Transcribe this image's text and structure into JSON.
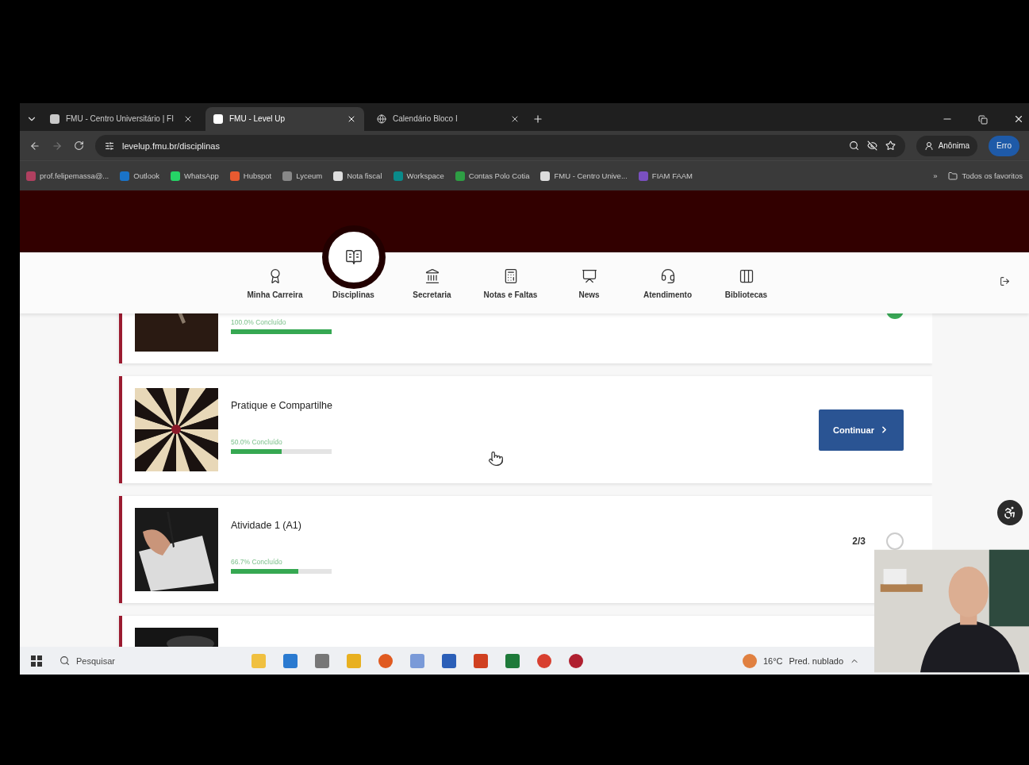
{
  "browser": {
    "tabs": [
      {
        "title": "FMU - Centro Universitário | FI",
        "selected": false
      },
      {
        "title": "FMU - Level Up",
        "selected": true
      },
      {
        "title": "Calendário Bloco I",
        "selected": false
      }
    ],
    "address": "levelup.fmu.br/disciplinas",
    "profile": "Anônima",
    "error_badge": "Erro",
    "bookmarks": [
      "prof.felipemassa@...",
      "Outlook",
      "WhatsApp",
      "Hubspot",
      "Lyceum",
      "Nota fiscal",
      "Workspace",
      "Contas Polo Cotia",
      "FMU - Centro Unive...",
      "FIAM FAAM"
    ],
    "bookmarks_more": "»",
    "all_bookmarks": "Todos os favoritos"
  },
  "nav": [
    {
      "label": "Minha Carreira",
      "kind": "career",
      "selected": false
    },
    {
      "label": "Disciplinas",
      "kind": "subjects",
      "selected": true
    },
    {
      "label": "Secretaria",
      "kind": "office",
      "selected": false
    },
    {
      "label": "Notas e Faltas",
      "kind": "grades",
      "selected": false
    },
    {
      "label": "News",
      "kind": "news",
      "selected": false
    },
    {
      "label": "Atendimento",
      "kind": "support",
      "selected": false
    },
    {
      "label": "Bibliotecas",
      "kind": "library",
      "selected": false
    }
  ],
  "cards": [
    {
      "kind": "progress",
      "progress_label": "100.0% Concluído",
      "level": 1,
      "done": true
    },
    {
      "kind": "progress",
      "title": "Pratique e Compartilhe",
      "progress_label": "50.0% Concluído",
      "level": 0.5,
      "button": "Continuar"
    },
    {
      "kind": "progress",
      "title": "Atividade 1 (A1)",
      "progress_label": "66.7% Concluído",
      "level": 0.667,
      "count": "2/3",
      "done": false
    },
    {
      "kind": "picture"
    }
  ],
  "taskbar": {
    "search": "Pesquisar",
    "temperature": "16°C",
    "weather": "Pred. nublado"
  }
}
